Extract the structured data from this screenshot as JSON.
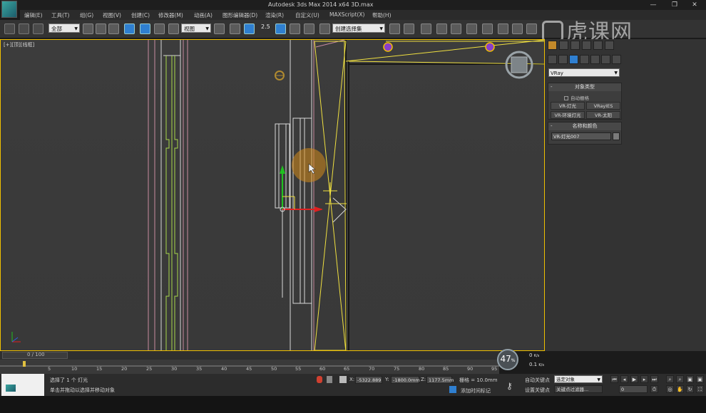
{
  "title_bar": {
    "title": "Autodesk 3ds Max  2014 x64     3D.max",
    "minimize": "—",
    "restore": "❐",
    "close": "✕"
  },
  "menu": [
    {
      "label": "编辑(E)"
    },
    {
      "label": "工具(T)"
    },
    {
      "label": "组(G)"
    },
    {
      "label": "视图(V)"
    },
    {
      "label": "创建(C)"
    },
    {
      "label": "修改器(M)"
    },
    {
      "label": "动画(A)"
    },
    {
      "label": "图形编辑器(D)"
    },
    {
      "label": "渲染(R)"
    },
    {
      "label": "自定义(U)"
    },
    {
      "label": "MAXScript(X)"
    },
    {
      "label": "帮助(H)"
    }
  ],
  "toolbar": {
    "filter_value": "全部",
    "ref_coord_value": "视图",
    "snap_label": "2.5",
    "selection_set_value": "创建选择集"
  },
  "viewport": {
    "label": "[+][顶][线框]"
  },
  "command_panel": {
    "renderer_value": "VRay",
    "object_type": {
      "header": "对象类型",
      "autogrid": "自动栅格",
      "buttons": [
        "VR-灯光",
        "VRayIES",
        "VR-环境灯光",
        "VR-太阳"
      ]
    },
    "name_color": {
      "header": "名称和颜色",
      "name_value": "VR-灯光007"
    }
  },
  "time_slider": {
    "label": "0 / 100"
  },
  "track_numbers": [
    "5",
    "10",
    "15",
    "20",
    "25",
    "30",
    "35",
    "40",
    "45",
    "50",
    "55",
    "60",
    "65",
    "70",
    "75",
    "80",
    "85",
    "90",
    "95"
  ],
  "status": {
    "selected": "选择了 1 个 灯光",
    "prompt": "单击并拖动以选择并移动对象",
    "x_label": "X:",
    "x_value": "-5322.889",
    "y_label": "Y:",
    "y_value": "-1800.0mm",
    "z_label": "Z:",
    "z_value": "1177.5mm",
    "grid": "栅格 = 10.0mm",
    "add_time_tag": "添加时间标记",
    "auto_key": "自动关键点",
    "set_key": "设置关键点",
    "selected_object": "选定对象",
    "key_filters": "关键点过滤器...",
    "frame_value": "0"
  },
  "overlay": {
    "gauge_value": "47",
    "gauge_unit": "%",
    "speed_up": "0",
    "speed_up_unit": "K/s",
    "speed_down": "0.1",
    "speed_down_unit": "K/s",
    "watermark": "虎课网"
  },
  "colors": {
    "viewport_border": "#f0c000",
    "wire_yellow": "#f0e040",
    "wire_green": "#a8d84a",
    "wire_pink": "#c98ca0",
    "wire_white": "#d8d8d8",
    "gizmo_red": "#e02020",
    "gizmo_green": "#20c020"
  }
}
